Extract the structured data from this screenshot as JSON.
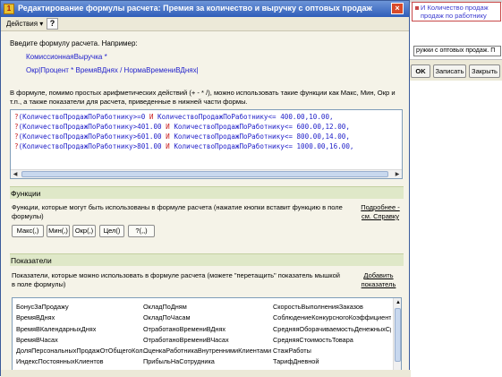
{
  "background_window": {
    "list_items": [
      "И Количество продаж",
      "продаж по работнику"
    ],
    "field_value": "ружки с оптовых продаж. П",
    "buttons": {
      "ok": "OK",
      "save": "Записать",
      "close": "Закрыть"
    }
  },
  "dialog": {
    "title": "Редактирование формулы расчета: Премия за количество и выручку с оптовых продаж",
    "close_glyph": "×",
    "toolbar": {
      "actions_label": "Действия ▾",
      "help_label": "?"
    },
    "intro": "Введите формулу расчета. Например:",
    "example_line_1": "КомиссионнаяВыручка *",
    "example_line_2": "Окр|Процент * ВремяВДнях / НормаВремениВДнях|",
    "explanation": "В формуле, помимо простых арифметических действий (+ - * /), можно использовать такие функции как Макс, Мин, Окр и т.п., а также показатели для расчета, приведенные в нижней части формы.",
    "formula_lines": [
      {
        "q": "?",
        "a": "(КоличествоПродажПоРаботнику",
        "b": ">=0 ",
        "kw": "И",
        "c": " КоличествоПродажПоРаботнику<= 400.00,10.00,"
      },
      {
        "q": "?",
        "a": "(КоличествоПродажПоРаботнику",
        "b": ">401.00 ",
        "kw": "И",
        "c": " КоличествоПродажПоРаботнику<= 600.00,12.00,"
      },
      {
        "q": "?",
        "a": "(КоличествоПродажПоРаботнику",
        "b": ">601.00 ",
        "kw": "И",
        "c": " КоличествоПродажПоРаботнику<= 800.00,14.00,"
      },
      {
        "q": "?",
        "a": "(КоличествоПродажПоРаботнику",
        "b": ">801.00 ",
        "kw": "И",
        "c": " КоличествоПродажПоРаботнику<= 1000.00,16.00,"
      }
    ],
    "functions": {
      "header": "Функции",
      "description": "Функции, которые могут быть использованы в формуле расчета (нажатие кнопки вставит функцию в поле формулы)",
      "more_link": "Подробнее - см. Справку",
      "buttons": [
        "Макс(,)",
        "Мин(,)",
        "Окр(,)",
        "Цел()",
        "?(,,)"
      ]
    },
    "indicators": {
      "header": "Показатели",
      "description": "Показатели, которые можно использовать в формуле расчета (можете \"перетащить\" показатель мышкой в поле формулы)",
      "add_link": "Добавить показатель",
      "column_1": [
        "БонусЗаПродажу",
        "ВремяВДнях",
        "ВремяВКалендарныхДнях",
        "ВремяВЧасах",
        "ДоляПерсональныхПродажОтОбщегоКол...",
        "ИндексПостоянныхКлиентов"
      ],
      "column_2": [
        "ОкладПоДням",
        "ОкладПоЧасам",
        "ОтработаноВремениВДнях",
        "ОтработаноВремениВЧасах",
        "ОценкаРаботникаВнутреннимиКлиентами",
        "ПрибыльНаСотрудника"
      ],
      "column_3": [
        "СкоростьВыполненияЗаказов",
        "СоблюдениеКонкурсногоКоэффициента...",
        "СредняяОборачиваемостьДенежныхСр...",
        "СредняяСтоимостьТовара",
        "СтажРаботы",
        "ТарифДневной"
      ]
    }
  }
}
